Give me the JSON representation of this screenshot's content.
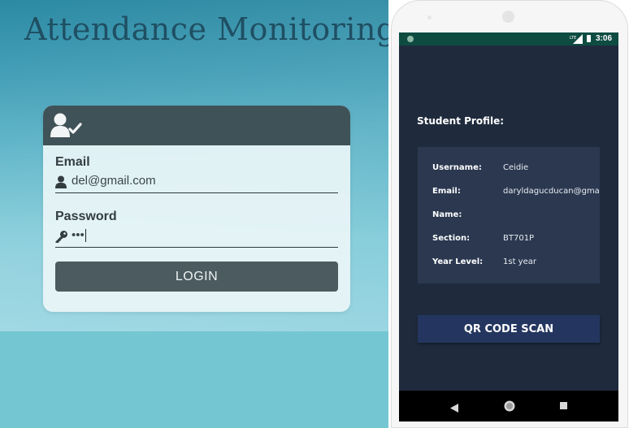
{
  "web": {
    "title": "Attendance Monitoring",
    "email": {
      "label": "Email",
      "value": "del@gmail.com"
    },
    "password": {
      "label": "Password",
      "value": "•••"
    },
    "login_label": "LOGIN",
    "icons": {
      "header": "user-check-icon",
      "email": "user-icon",
      "password": "key-icon"
    }
  },
  "phone": {
    "status": {
      "time": "3:06",
      "network": "LTE"
    },
    "profile_heading": "Student Profile:",
    "profile": [
      {
        "key": "Username:",
        "value": "Ceidie"
      },
      {
        "key": "Email:",
        "value": "daryldagucducan@gma"
      },
      {
        "key": "Name:",
        "value": ""
      },
      {
        "key": "Section:",
        "value": "BT701P"
      },
      {
        "key": "Year Level:",
        "value": "1st year"
      }
    ],
    "qr_label": "QR CODE SCAN",
    "nav": [
      "back-icon",
      "home-icon",
      "recents-icon"
    ]
  },
  "colors": {
    "card_header": "#3f5257",
    "login_button": "#4b5b5f",
    "phone_bg": "#1f2b3d",
    "profile_card": "#2b3850",
    "qr_button": "#24365f",
    "status_bar": "#0e4c42"
  }
}
